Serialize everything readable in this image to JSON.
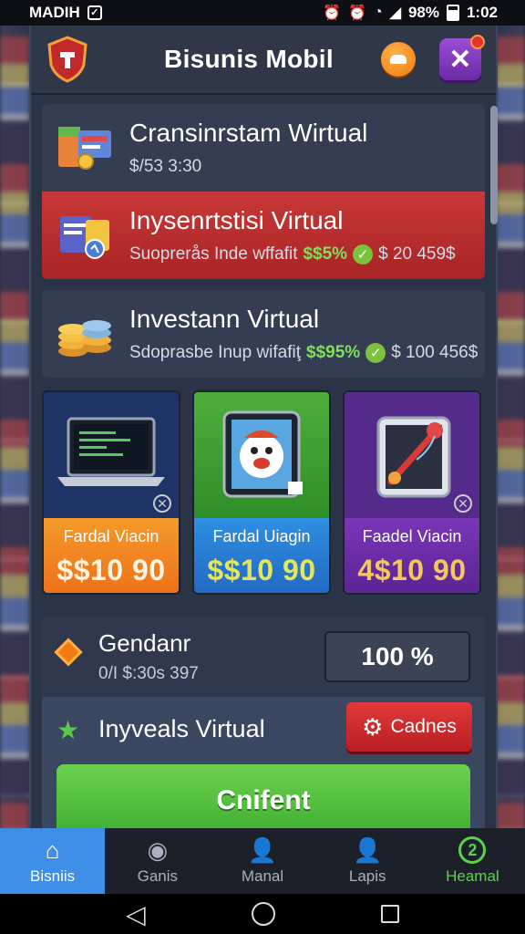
{
  "status_bar": {
    "carrier": "MADIH",
    "battery": "98%",
    "time": "1:02"
  },
  "header": {
    "title": "Bisunis Mobil"
  },
  "list": [
    {
      "title": "Cransinrstam Wirtual",
      "subtitle": "$/53 3:30"
    },
    {
      "title": "Inysenrtstisi Virtual",
      "subtitle": "Suoprerås Inde wffafit",
      "green": "$$5%",
      "amount": "$ 20 459$"
    },
    {
      "title": "Investann Virtual",
      "subtitle": "Sdoprasbe Inup wifafiţ",
      "green": "$$95%",
      "amount": "$ 100 456$"
    }
  ],
  "tiles": [
    {
      "label": "Fardal Viacin",
      "price": "$$10 90"
    },
    {
      "label": "Fardal Uiagin",
      "price": "$$10 90"
    },
    {
      "label": "Faadel Viacin",
      "price": "4$10 90"
    }
  ],
  "gendanr": {
    "title": "Gendanr",
    "subtitle": "0/I $:30s 397",
    "percent": "100 %"
  },
  "invest": {
    "title": "Inyveals Virtual",
    "settings_label": "Cadnes",
    "confirm_label": "Cnifent"
  },
  "nav": [
    {
      "label": "Bisniis",
      "icon": "home-icon"
    },
    {
      "label": "Ganis",
      "icon": "check-circle-icon"
    },
    {
      "label": "Manal",
      "icon": "user-icon"
    },
    {
      "label": "Lapis",
      "icon": "user-icon"
    },
    {
      "label": "Heamal",
      "icon": "badge-2-icon",
      "badge": "2"
    }
  ],
  "colors": {
    "accent_blue": "#3f8ee8",
    "danger_red": "#c93838",
    "success_green": "#5ad24a",
    "panel": "#2b3346"
  }
}
